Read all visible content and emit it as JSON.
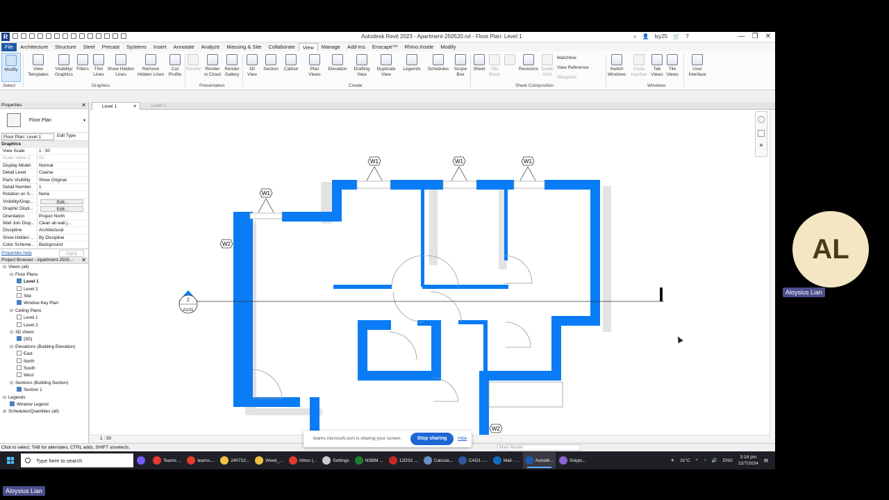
{
  "window": {
    "title": "Autodesk Revit 2023 - Apartment-250520.rvt - Floor Plan: Level 1",
    "user": "lsy25",
    "app_icon": "R"
  },
  "tabs": [
    "File",
    "Architecture",
    "Structure",
    "Steel",
    "Precast",
    "Systems",
    "Insert",
    "Annotate",
    "Analyze",
    "Massing & Site",
    "Collaborate",
    "View",
    "Manage",
    "Add-Ins",
    "Enscape™",
    "Rhino.Inside",
    "Modify"
  ],
  "ribbon": {
    "select_label": "Select",
    "buttons": [
      {
        "label": "Modify"
      },
      {
        "label": "View Templates"
      },
      {
        "label": "Visibility/ Graphics"
      },
      {
        "label": "Filters"
      },
      {
        "label": "Thin Lines"
      },
      {
        "label": "Show Hidden Lines"
      },
      {
        "label": "Remove Hidden Lines"
      },
      {
        "label": "Cut Profile"
      },
      {
        "label": "Render"
      },
      {
        "label": "Render in Cloud"
      },
      {
        "label": "Render Gallery"
      },
      {
        "label": "3D View"
      },
      {
        "label": "Section"
      },
      {
        "label": "Callout"
      },
      {
        "label": "Plan Views"
      },
      {
        "label": "Elevation"
      },
      {
        "label": "Drafting View"
      },
      {
        "label": "Duplicate View"
      },
      {
        "label": "Legends"
      },
      {
        "label": "Schedules"
      },
      {
        "label": "Scope Box"
      },
      {
        "label": "Sheet"
      },
      {
        "label": "Title Block"
      },
      {
        "label": "Revisions"
      },
      {
        "label": "Guide Grid"
      },
      {
        "label": "Switch Windows"
      },
      {
        "label": "Close Inactive"
      },
      {
        "label": "Tab Views"
      },
      {
        "label": "Tile Views"
      },
      {
        "label": "User Interface"
      }
    ],
    "sheet_side": [
      "Matchline",
      "View Reference",
      "Viewports"
    ],
    "panels": [
      "Graphics",
      "Presentation",
      "Create",
      "Sheet Composition",
      "Windows"
    ]
  },
  "properties": {
    "header": "Properties",
    "type_name": "Floor Plan",
    "selector": "Floor Plan: Level 1",
    "edit_type": "Edit Type",
    "group": "Graphics",
    "rows": [
      {
        "k": "View Scale",
        "v": "1 : 50"
      },
      {
        "k": "Scale Value    1:",
        "v": "50"
      },
      {
        "k": "Display Model",
        "v": "Normal"
      },
      {
        "k": "Detail Level",
        "v": "Coarse"
      },
      {
        "k": "Parts Visibility",
        "v": "Show Original"
      },
      {
        "k": "Detail Number",
        "v": "1"
      },
      {
        "k": "Rotation on S...",
        "v": "None"
      },
      {
        "k": "Visibility/Grap...",
        "v": "Edit..."
      },
      {
        "k": "Graphic Displ...",
        "v": "Edit..."
      },
      {
        "k": "Orientation",
        "v": "Project North"
      },
      {
        "k": "Wall Join Disp...",
        "v": "Clean all wall j..."
      },
      {
        "k": "Discipline",
        "v": "Architectural"
      },
      {
        "k": "Show Hidden ...",
        "v": "By Discipline"
      },
      {
        "k": "Color Scheme...",
        "v": "Background"
      }
    ],
    "help_link": "Properties help",
    "apply": "Apply"
  },
  "browser": {
    "header": "Project Browser - Apartment-2505...",
    "items": [
      {
        "label": "Views (all)",
        "level": 0,
        "toggle": "⊟"
      },
      {
        "label": "Floor Plans",
        "level": 1,
        "toggle": "⊟"
      },
      {
        "label": "Level 1",
        "level": 2,
        "cb": "on",
        "bold": true
      },
      {
        "label": "Level 2",
        "level": 2,
        "cb": "off"
      },
      {
        "label": "Site",
        "level": 2,
        "cb": "off"
      },
      {
        "label": "Window Key Plan",
        "level": 2,
        "cb": "on"
      },
      {
        "label": "Ceiling Plans",
        "level": 1,
        "toggle": "⊟"
      },
      {
        "label": "Level 1",
        "level": 2,
        "cb": "off"
      },
      {
        "label": "Level 2",
        "level": 2,
        "cb": "off"
      },
      {
        "label": "3D Views",
        "level": 1,
        "toggle": "⊟"
      },
      {
        "label": "{3D}",
        "level": 2,
        "cb": "on"
      },
      {
        "label": "Elevations (Building Elevation)",
        "level": 1,
        "toggle": "⊟"
      },
      {
        "label": "East",
        "level": 2,
        "cb": "off"
      },
      {
        "label": "North",
        "level": 2,
        "cb": "off"
      },
      {
        "label": "South",
        "level": 2,
        "cb": "off"
      },
      {
        "label": "West",
        "level": 2,
        "cb": "off"
      },
      {
        "label": "Sections (Building Section)",
        "level": 1,
        "toggle": "⊟"
      },
      {
        "label": "Section 1",
        "level": 2,
        "cb": "on"
      },
      {
        "label": "Legends",
        "level": 0,
        "toggle": "⊟"
      },
      {
        "label": "Window Legend",
        "level": 1,
        "cb": "on"
      },
      {
        "label": "Schedules/Quantities (all)",
        "level": 0,
        "toggle": "⊞"
      }
    ]
  },
  "doc_tabs": [
    {
      "label": "Level 1"
    },
    {
      "label": "Level 1"
    }
  ],
  "plan": {
    "window_tags": [
      "W1",
      "W1",
      "W1",
      "W1"
    ],
    "w2_tags": [
      "W2",
      "W2"
    ],
    "section_number": "2",
    "section_sheet": "A101"
  },
  "view_scale": "1 : 50",
  "status": {
    "hint": "Click to select, TAB for alternates, CTRL adds, SHIFT unselects.",
    "model": "Main Model"
  },
  "share": {
    "text": "teams.microsoft.com is sharing your screen.",
    "stop": "Stop sharing",
    "hide": "Hide"
  },
  "taskbar": {
    "search_placeholder": "Type here to search",
    "apps": [
      {
        "label": "",
        "color": "#7a5cff"
      },
      {
        "label": "Teams ...",
        "color": "#e33b2e"
      },
      {
        "label": "teams....",
        "color": "#e33b2e"
      },
      {
        "label": "240722...",
        "color": "#f0c040"
      },
      {
        "label": "Week_...",
        "color": "#f0c040"
      },
      {
        "label": "Inbox (...",
        "color": "#e33b2e"
      },
      {
        "label": "Settings",
        "color": "#cccccc"
      },
      {
        "label": "NSBM ...",
        "color": "#1e7e34"
      },
      {
        "label": "12DS1 ...",
        "color": "#c62828"
      },
      {
        "label": "Calcula...",
        "color": "#6c8ebf"
      },
      {
        "label": "CAD1 -...",
        "color": "#2b579a"
      },
      {
        "label": "Mail - ...",
        "color": "#0f6cbd"
      },
      {
        "label": "Autode...",
        "color": "#1e5aa8"
      },
      {
        "label": "Snippi...",
        "color": "#8a63d2"
      }
    ],
    "weather": "31°C",
    "lang": "ENG",
    "time": "3:18 pm",
    "date": "22/7/2024"
  },
  "participant": {
    "initials": "AL",
    "name": "Aloysius Lian"
  },
  "presenter": {
    "name": "Aloysius Lian"
  },
  "colors": {
    "wall": "#0a7cf5",
    "accent": "#1e5aa8",
    "teams": "#4b4e8c"
  }
}
